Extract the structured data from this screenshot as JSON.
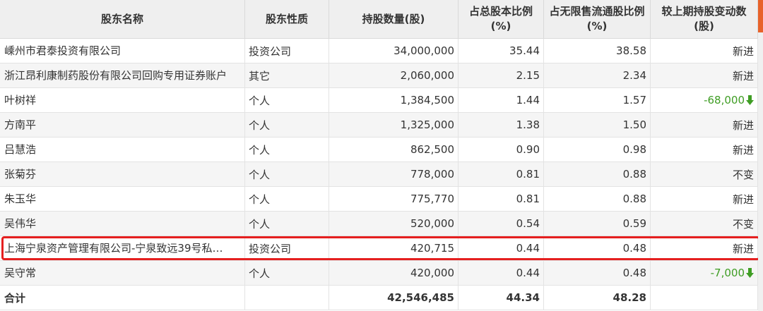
{
  "colors": {
    "header_bg": "#efefef",
    "alt_row": "#f5f5f5",
    "decrease": "#3f9d24",
    "highlight": "#e51f1f",
    "accent": "#e8622a"
  },
  "headers": [
    "股东名称",
    "股东性质",
    "持股数量(股)",
    "占总股本比例(%)",
    "占无限售流通股比例(%)",
    "较上期持股变动数(股)"
  ],
  "rows": [
    {
      "name": "嵊州市君泰投资有限公司",
      "nature": "投资公司",
      "shares": "34,000,000",
      "pct_total": "35.44",
      "pct_float": "38.58",
      "change": "新进"
    },
    {
      "name": "浙江昂利康制药股份有限公司回购专用证券账户",
      "nature": "其它",
      "shares": "2,060,000",
      "pct_total": "2.15",
      "pct_float": "2.34",
      "change": "新进"
    },
    {
      "name": "叶树祥",
      "nature": "个人",
      "shares": "1,384,500",
      "pct_total": "1.44",
      "pct_float": "1.57",
      "change": "-68,000",
      "change_icon": "down-arrow-icon"
    },
    {
      "name": "方南平",
      "nature": "个人",
      "shares": "1,325,000",
      "pct_total": "1.38",
      "pct_float": "1.50",
      "change": "新进"
    },
    {
      "name": "吕慧浩",
      "nature": "个人",
      "shares": "862,500",
      "pct_total": "0.90",
      "pct_float": "0.98",
      "change": "新进"
    },
    {
      "name": "张菊芬",
      "nature": "个人",
      "shares": "778,000",
      "pct_total": "0.81",
      "pct_float": "0.88",
      "change": "不变"
    },
    {
      "name": "朱玉华",
      "nature": "个人",
      "shares": "775,770",
      "pct_total": "0.81",
      "pct_float": "0.88",
      "change": "新进"
    },
    {
      "name": "吴伟华",
      "nature": "个人",
      "shares": "520,000",
      "pct_total": "0.54",
      "pct_float": "0.59",
      "change": "不变"
    },
    {
      "name": "上海宁泉资产管理有限公司-宁泉致远39号私…",
      "nature": "投资公司",
      "shares": "420,715",
      "pct_total": "0.44",
      "pct_float": "0.48",
      "change": "新进"
    },
    {
      "name": "吴守常",
      "nature": "个人",
      "shares": "420,000",
      "pct_total": "0.44",
      "pct_float": "0.48",
      "change": "-7,000",
      "change_icon": "down-arrow-icon"
    }
  ],
  "total": {
    "label": "合计",
    "shares": "42,546,485",
    "pct_total": "44.34",
    "pct_float": "48.28"
  }
}
